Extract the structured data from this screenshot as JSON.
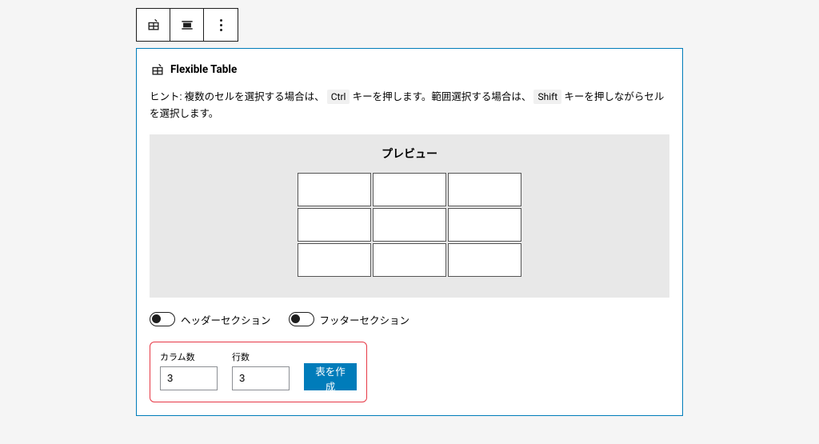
{
  "block": {
    "title": "Flexible Table",
    "hint_prefix": "ヒント: 複数のセルを選択する場合は、",
    "hint_key1": "Ctrl",
    "hint_mid": "キーを押します。範囲選択する場合は、",
    "hint_key2": "Shift",
    "hint_suffix": "キーを押しながらセルを選択します。"
  },
  "preview": {
    "title": "プレビュー",
    "rows": 3,
    "cols": 3
  },
  "toggles": {
    "header_label": "ヘッダーセクション",
    "footer_label": "フッターセクション"
  },
  "create": {
    "columns_label": "カラム数",
    "rows_label": "行数",
    "columns_value": "3",
    "rows_value": "3",
    "button_label": "表を作成"
  }
}
